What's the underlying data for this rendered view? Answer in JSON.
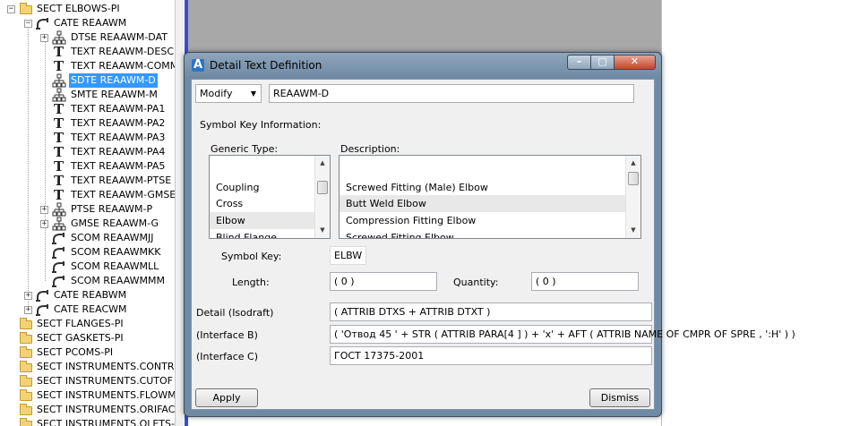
{
  "tree": {
    "rows": [
      {
        "label": "SECT ELBOWS-PI"
      },
      {
        "label": "CATE REAAWM"
      },
      {
        "label": "DTSE REAAWM-DAT"
      },
      {
        "label": "TEXT REAAWM-DESC"
      },
      {
        "label": "TEXT REAAWM-COMM"
      },
      {
        "label": "SDTE REAAWM-D"
      },
      {
        "label": "SMTE REAAWM-M"
      },
      {
        "label": "TEXT REAAWM-PA1"
      },
      {
        "label": "TEXT REAAWM-PA2"
      },
      {
        "label": "TEXT REAAWM-PA3"
      },
      {
        "label": "TEXT REAAWM-PA4"
      },
      {
        "label": "TEXT REAAWM-PA5"
      },
      {
        "label": "TEXT REAAWM-PTSE"
      },
      {
        "label": "TEXT REAAWM-GMSE"
      },
      {
        "label": "PTSE REAAWM-P"
      },
      {
        "label": "GMSE REAAWM-G"
      },
      {
        "label": "SCOM REAAWMJJ"
      },
      {
        "label": "SCOM REAAWMKK"
      },
      {
        "label": "SCOM REAAWMLL"
      },
      {
        "label": "SCOM REAAWMMM"
      },
      {
        "label": "CATE REABWM"
      },
      {
        "label": "CATE REACWM"
      },
      {
        "label": "SECT FLANGES-PI"
      },
      {
        "label": "SECT GASKETS-PI"
      },
      {
        "label": "SECT PCOMS-PI"
      },
      {
        "label": "SECT INSTRUMENTS.CONTR"
      },
      {
        "label": "SECT INSTRUMENTS.CUTOF"
      },
      {
        "label": "SECT INSTRUMENTS.FLOWM"
      },
      {
        "label": "SECT INSTRUMENTS.ORIFAC"
      },
      {
        "label": "SECT INSTRUMENTS.OLETS-"
      }
    ]
  },
  "dialog": {
    "title": "Detail Text Definition",
    "mode_select": "Modify",
    "name_value": "REAAWM-D",
    "symbol_key_info_label": "Symbol Key Information:",
    "generic_type_label": "Generic Type:",
    "description_label": "Description:",
    "generic_types": [
      "",
      "Coupling",
      "Cross",
      "Elbow",
      "Blind Flange"
    ],
    "descriptions": [
      "",
      "Screwed Fitting (Male) Elbow",
      "Butt Weld Elbow",
      "Compression Fitting Elbow",
      "Screwed Fitting Elbow"
    ],
    "symbol_key_label": "Symbol Key:",
    "symbol_key_value": "ELBW",
    "length_label": "Length:",
    "length_value": "( 0 )",
    "quantity_label": "Quantity:",
    "quantity_value": "( 0 )",
    "detail_label": "Detail (Isodraft)",
    "detail_value": "( ATTRIB DTXS + ATTRIB DTXT )",
    "interface_b_label": "(Interface B)",
    "interface_b_value": "( 'Отвод 45 ' + STR ( ATTRIB PARA[4 ] ) + 'x' + AFT ( ATTRIB NAME OF CMPR OF SPRE , ':H' ) )",
    "interface_c_label": "(Interface C)",
    "interface_c_value": "ГОСТ 17375-2001",
    "apply_label": "Apply",
    "dismiss_label": "Dismiss"
  }
}
